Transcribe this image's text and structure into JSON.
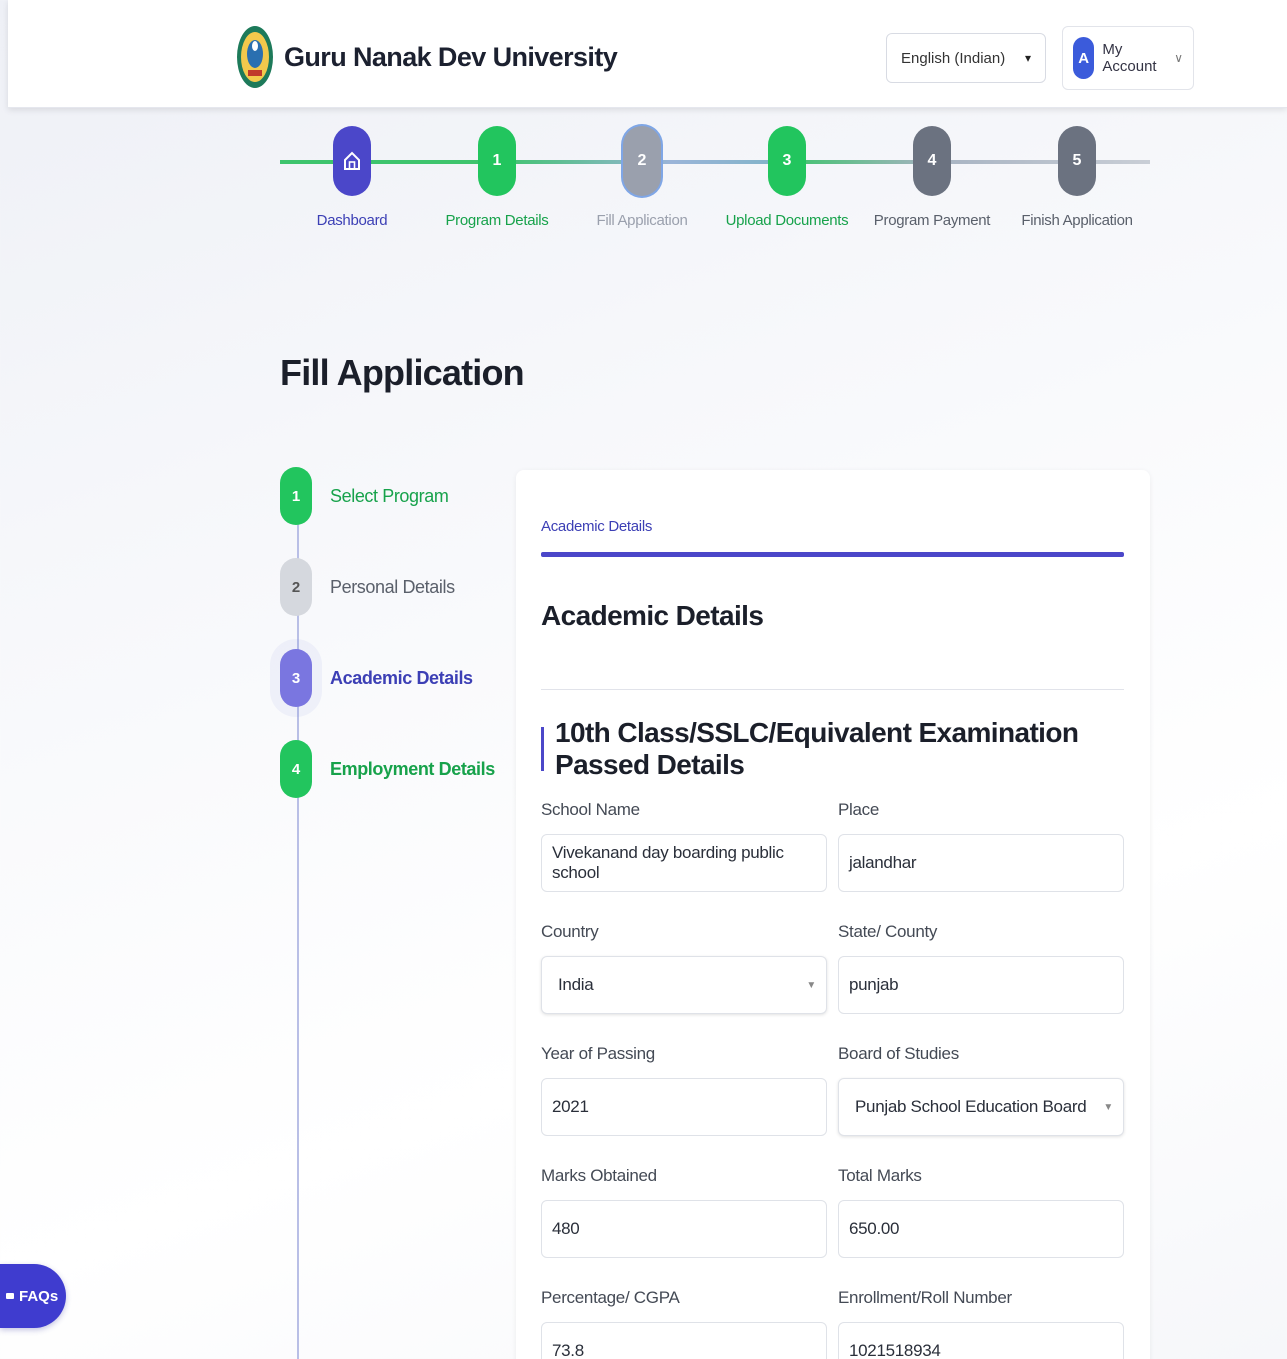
{
  "header": {
    "brand": "Guru Nanak Dev University",
    "language": "English (Indian)",
    "account_initial": "A",
    "account_label": "My Account"
  },
  "stepper": [
    {
      "label": "Dashboard",
      "number": "",
      "state": "active"
    },
    {
      "label": "Program Details",
      "number": "1",
      "state": "done"
    },
    {
      "label": "Fill Application",
      "number": "2",
      "state": "current"
    },
    {
      "label": "Upload Documents",
      "number": "3",
      "state": "done"
    },
    {
      "label": "Program Payment",
      "number": "4",
      "state": "pending"
    },
    {
      "label": "Finish Application",
      "number": "5",
      "state": "pending"
    }
  ],
  "page_title": "Fill Application",
  "side_steps": [
    {
      "number": "1",
      "label": "Select Program",
      "state": "done"
    },
    {
      "number": "2",
      "label": "Personal Details",
      "state": "pending"
    },
    {
      "number": "3",
      "label": "Academic Details",
      "state": "active"
    },
    {
      "number": "4",
      "label": "Employment Details",
      "state": "done"
    }
  ],
  "card": {
    "tab": "Academic Details",
    "title": "Academic Details",
    "section": "10th Class/SSLC/Equivalent Examination Passed Details",
    "fields": {
      "school_name": {
        "label": "School Name",
        "value": "Vivekanand day boarding public school"
      },
      "place": {
        "label": "Place",
        "value": "jalandhar"
      },
      "country": {
        "label": "Country",
        "value": "India"
      },
      "state": {
        "label": "State/ County",
        "value": "punjab"
      },
      "year": {
        "label": "Year of Passing",
        "value": "2021"
      },
      "board": {
        "label": "Board of Studies",
        "value": "Punjab School Education Board"
      },
      "marks": {
        "label": "Marks Obtained",
        "value": "480"
      },
      "total": {
        "label": "Total Marks",
        "value": "650.00"
      },
      "percentage": {
        "label": "Percentage/ CGPA",
        "value": "73.8"
      },
      "roll": {
        "label": "Enrollment/Roll Number",
        "value": "1021518934"
      }
    }
  },
  "faq_label": "FAQs",
  "colors": {
    "primary": "#4b47c9",
    "success": "#22c55e",
    "pending": "#6b7280",
    "current": "#9aa0ad"
  }
}
